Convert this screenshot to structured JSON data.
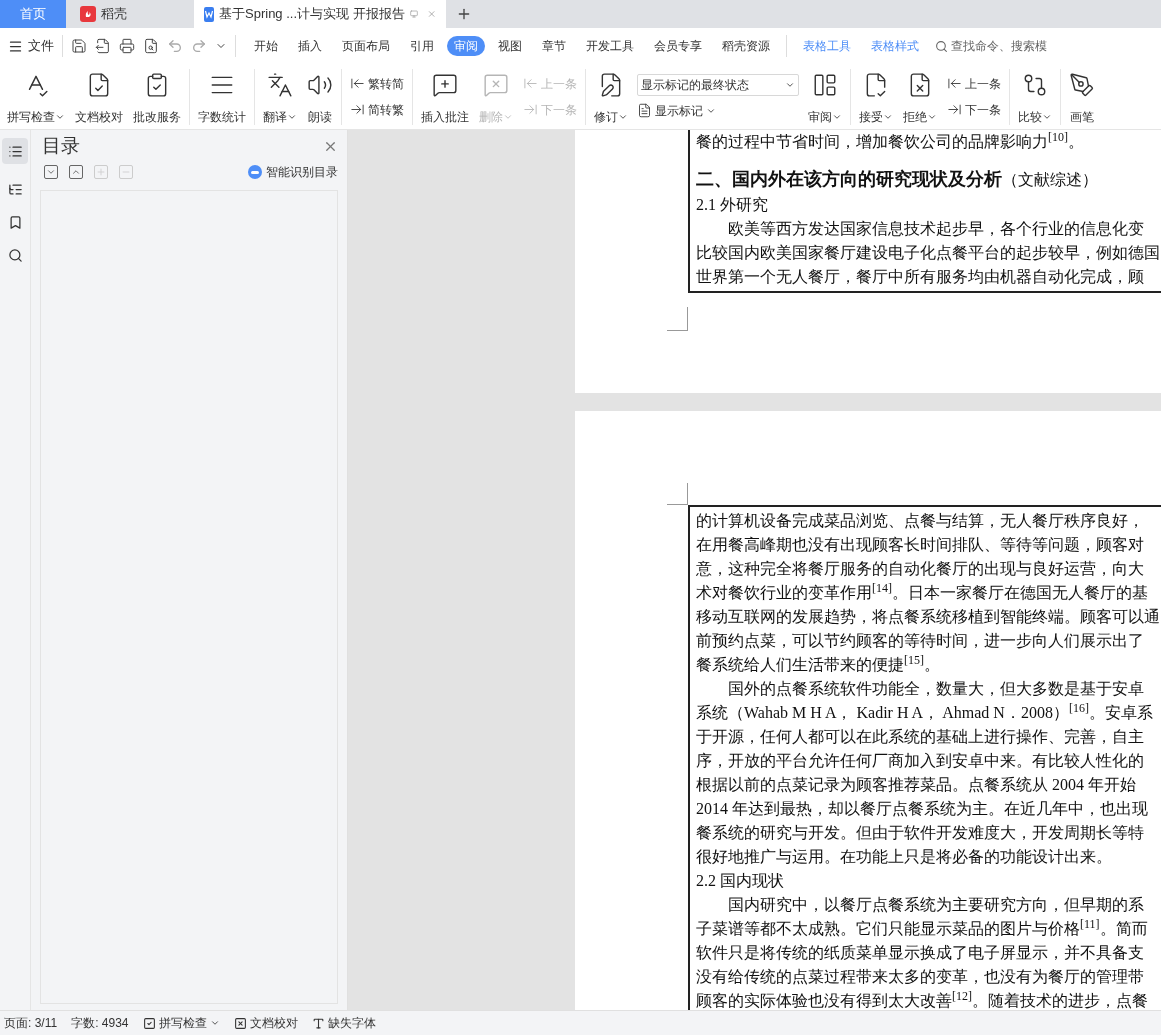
{
  "tabs": [
    {
      "kind": "home",
      "label": "首页",
      "selected": false
    },
    {
      "kind": "docer",
      "label": "稻壳",
      "selected": false
    },
    {
      "kind": "doc",
      "label": "基于Spring ...计与实现 开报报告",
      "selected": true
    }
  ],
  "menu": {
    "file": "文件",
    "tabs": [
      {
        "label": "开始",
        "selected": false,
        "kind": "main"
      },
      {
        "label": "插入",
        "selected": false,
        "kind": "main"
      },
      {
        "label": "页面布局",
        "selected": false,
        "kind": "main"
      },
      {
        "label": "引用",
        "selected": false,
        "kind": "main"
      },
      {
        "label": "审阅",
        "selected": true,
        "kind": "main"
      },
      {
        "label": "视图",
        "selected": false,
        "kind": "main"
      },
      {
        "label": "章节",
        "selected": false,
        "kind": "main"
      },
      {
        "label": "开发工具",
        "selected": false,
        "kind": "main"
      },
      {
        "label": "会员专享",
        "selected": false,
        "kind": "main"
      },
      {
        "label": "稻壳资源",
        "selected": false,
        "kind": "main"
      },
      {
        "label": "表格工具",
        "selected": false,
        "kind": "context"
      },
      {
        "label": "表格样式",
        "selected": false,
        "kind": "context"
      }
    ],
    "search": {
      "placeholder": "查找命令、搜索模"
    }
  },
  "ribbon": [
    [
      {
        "kind": "large",
        "label": "拼写检查",
        "dropdown": true,
        "disabled": false
      },
      {
        "kind": "large",
        "label": "文档校对",
        "dropdown": false,
        "disabled": false
      },
      {
        "kind": "large",
        "label": "批改服务",
        "dropdown": false,
        "disabled": false
      }
    ],
    [
      {
        "kind": "large",
        "label": "字数统计",
        "dropdown": false,
        "disabled": false
      }
    ],
    [
      {
        "kind": "large",
        "label": "翻译",
        "dropdown": true,
        "disabled": false
      },
      {
        "kind": "large",
        "label": "朗读",
        "dropdown": false,
        "disabled": false
      }
    ],
    [
      {
        "kind": "pair",
        "labels": [
          "繁转简",
          "简转繁"
        ],
        "disabled": false
      }
    ],
    [
      {
        "kind": "large",
        "label": "插入批注",
        "dropdown": false,
        "disabled": false
      },
      {
        "kind": "large",
        "label": "删除",
        "dropdown": true,
        "disabled": true
      },
      {
        "kind": "pair",
        "labels": [
          "上一条",
          "下一条"
        ],
        "disabled": true
      }
    ],
    [
      {
        "kind": "large",
        "label": "修订",
        "dropdown": true,
        "disabled": false
      },
      {
        "kind": "select",
        "value": "显示标记的最终状态",
        "label": "显示标记"
      },
      {
        "kind": "large",
        "label": "审阅",
        "dropdown": true,
        "disabled": false
      }
    ],
    [
      {
        "kind": "large",
        "label": "接受",
        "dropdown": true,
        "disabled": false
      },
      {
        "kind": "large",
        "label": "拒绝",
        "dropdown": true,
        "disabled": false
      },
      {
        "kind": "pair",
        "labels": [
          "上一条",
          "下一条"
        ],
        "disabled": false
      }
    ],
    [
      {
        "kind": "large",
        "label": "比较",
        "dropdown": true,
        "disabled": false
      }
    ],
    [
      {
        "kind": "large",
        "label": "画笔",
        "dropdown": false,
        "disabled": false
      }
    ]
  ],
  "panel": {
    "title": "目录",
    "buttons": [
      {
        "kind": "collapse",
        "disabled": false
      },
      {
        "kind": "expand",
        "disabled": false
      },
      {
        "kind": "plus",
        "disabled": true
      },
      {
        "kind": "minus",
        "disabled": true
      }
    ],
    "smart": "智能识别目录"
  },
  "pages": [
    {
      "lines": [
        {
          "kind": "text",
          "text": "餐的过程中节省时间，增加餐饮公司的品牌影响力$^{[10]}$。"
        },
        {
          "kind": "title",
          "text": "二、国内外在该方向的研究现状及分析",
          "note": "（文献综述）"
        },
        {
          "kind": "heading",
          "text": "2.1 外研究"
        },
        {
          "kind": "indent",
          "text": "欧美等西方发达国家信息技术起步早，各个行业的信息化变"
        },
        {
          "kind": "text",
          "text": "比较国内欧美国家餐厅建设电子化点餐平台的起步较早，例如德国"
        },
        {
          "kind": "text",
          "text": "世界第一个无人餐厅，餐厅中所有服务均由机器自动化完成，顾"
        }
      ]
    },
    {
      "lines": [
        {
          "kind": "text",
          "text": "的计算机设备完成菜品浏览、点餐与结算，无人餐厅秩序良好，"
        },
        {
          "kind": "text",
          "text": "在用餐高峰期也没有出现顾客长时间排队、等待等问题，顾客对"
        },
        {
          "kind": "text",
          "text": "意，这种完全将餐厅服务的自动化餐厅的出现与良好运营，向大"
        },
        {
          "kind": "text",
          "text": "术对餐饮行业的变革作用$^{[14]}$。日本一家餐厅在德国无人餐厅的基"
        },
        {
          "kind": "text",
          "text": "移动互联网的发展趋势，将点餐系统移植到智能终端。顾客可以通"
        },
        {
          "kind": "text",
          "text": "前预约点菜，可以节约顾客的等待时间，进一步向人们展示出了"
        },
        {
          "kind": "text",
          "text": "餐系统给人们生活带来的便捷$^{[15]}$。"
        },
        {
          "kind": "indent",
          "text": "国外的点餐系统软件功能全，数量大，但大多数是基于安卓"
        },
        {
          "kind": "text",
          "text": "系统（Wahab M H A， Kadir H A， Ahmad N．2008）$^{[16]}$。安卓系"
        },
        {
          "kind": "text",
          "text": "于开源，任何人都可以在此系统的基础上进行操作、完善，自主"
        },
        {
          "kind": "text",
          "text": "序，开放的平台允许任何厂商加入到安卓中来。有比较人性化的"
        },
        {
          "kind": "text",
          "text": "根据以前的点菜记录为顾客推荐菜品。点餐系统从 2004 年开始"
        },
        {
          "kind": "text",
          "text": "2014 年达到最热，却以餐厅点餐系统为主。在近几年中，也出现"
        },
        {
          "kind": "text",
          "text": "餐系统的研究与开发。但由于软件开发难度大，开发周期长等特"
        },
        {
          "kind": "text",
          "text": "很好地推广与运用。在功能上只是将必备的功能设计出来。"
        },
        {
          "kind": "heading",
          "text": "2.2 国内现状"
        },
        {
          "kind": "indent",
          "text": "国内研究中，以餐厅点餐系统为主要研究方向，但早期的系"
        },
        {
          "kind": "text",
          "text": "子菜谱等都不太成熟。它们只能显示菜品的图片与价格$^{[11]}$。简而"
        },
        {
          "kind": "text",
          "text": "软件只是将传统的纸质菜单显示换成了电子屏显示，并不具备支"
        },
        {
          "kind": "text",
          "text": "没有给传统的点菜过程带来太多的变革，也没有为餐厅的管理带"
        },
        {
          "kind": "text",
          "text": "顾客的实际体验也没有得到太大改善$^{[12]}$。随着技术的进步，点餐"
        }
      ]
    }
  ],
  "status": [
    {
      "kind": "text",
      "label": "页面: 3/11"
    },
    {
      "kind": "text",
      "label": "字数: 4934"
    },
    {
      "kind": "check",
      "label": "拼写检查",
      "dropdown": true
    },
    {
      "kind": "doc",
      "label": "文档校对",
      "dropdown": false
    },
    {
      "kind": "font",
      "label": "缺失字体",
      "dropdown": false
    }
  ]
}
